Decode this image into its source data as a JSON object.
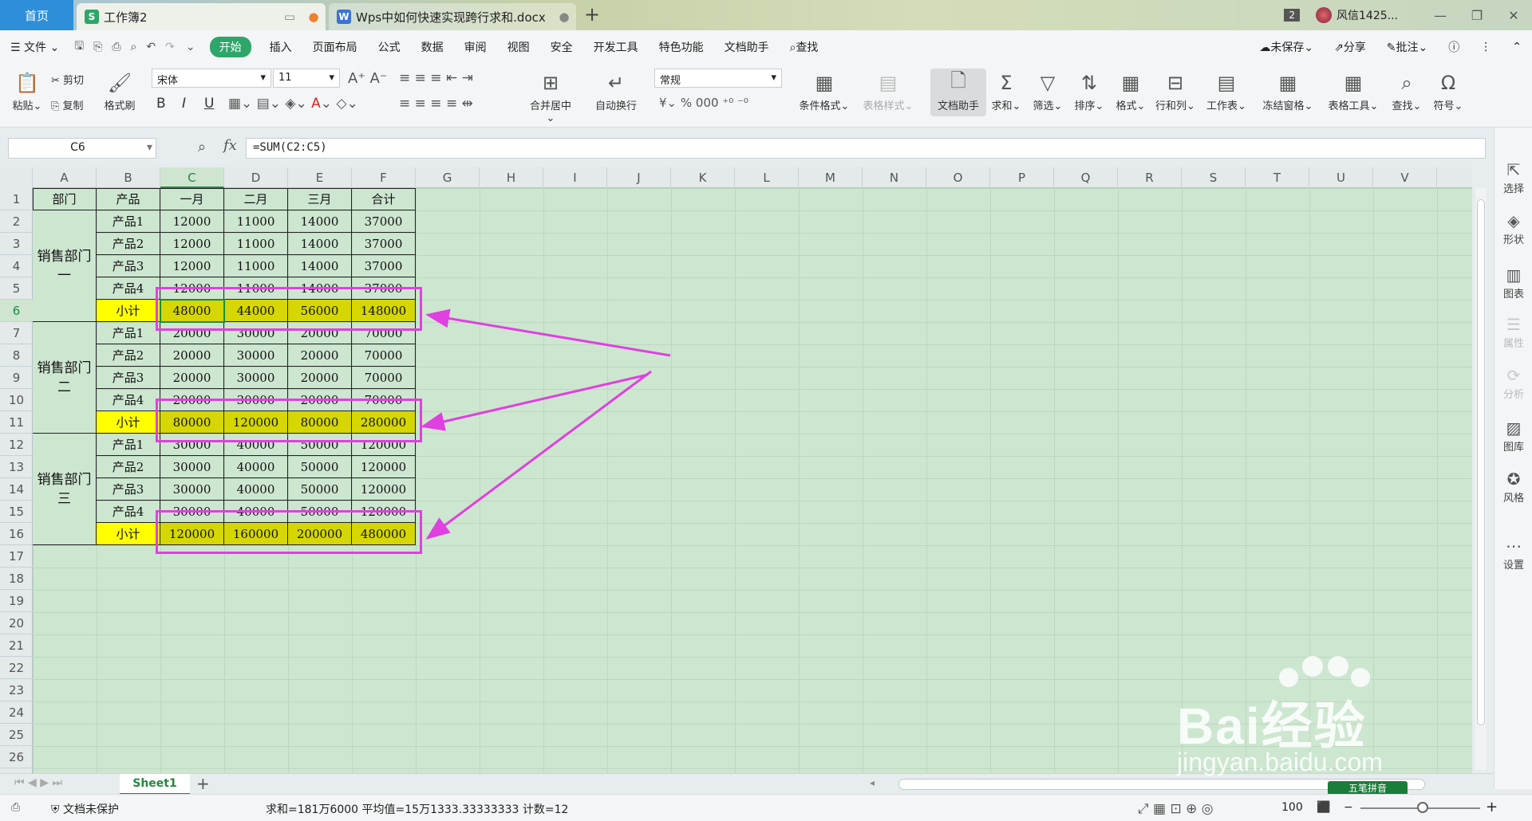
{
  "titlebar": {
    "home": "首页",
    "tab1": "工作簿2",
    "tab2": "Wps中如何快速实现跨行求和.docx",
    "count": "2",
    "user": "风信1425..."
  },
  "menu": {
    "file": "文件",
    "items": [
      "开始",
      "插入",
      "页面布局",
      "公式",
      "数据",
      "审阅",
      "视图",
      "安全",
      "开发工具",
      "特色功能",
      "文档助手",
      "查找"
    ],
    "unsaved": "未保存",
    "share": "分享",
    "comment": "批注"
  },
  "ribbon": {
    "paste": "粘贴",
    "cut": "剪切",
    "copy": "复制",
    "format_painter": "格式刷",
    "font": "宋体",
    "font_size": "11",
    "bold": "B",
    "italic": "I",
    "underline": "U",
    "merge": "合并居中",
    "wrap": "自动换行",
    "number_format": "常规",
    "cond_format": "条件格式",
    "table_style": "表格样式",
    "doc_helper": "文档助手",
    "sum": "求和",
    "filter": "筛选",
    "sort": "排序",
    "format": "格式",
    "rowcol": "行和列",
    "worksheet": "工作表",
    "freeze": "冻结窗格",
    "table_tools": "表格工具",
    "find": "查找",
    "symbol": "符号"
  },
  "formula_bar": {
    "cell_ref": "C6",
    "fx": "fx",
    "formula": "=SUM(C2:C5)"
  },
  "columns": [
    "A",
    "B",
    "C",
    "D",
    "E",
    "F",
    "G",
    "H",
    "I",
    "J",
    "K",
    "L",
    "M",
    "N",
    "O",
    "P",
    "Q",
    "R",
    "S",
    "T",
    "U",
    "V"
  ],
  "rows": [
    "1",
    "2",
    "3",
    "4",
    "5",
    "6",
    "7",
    "8",
    "9",
    "10",
    "11",
    "12",
    "13",
    "14",
    "15",
    "16",
    "17",
    "18",
    "19",
    "20",
    "21",
    "22",
    "23",
    "24",
    "25",
    "26"
  ],
  "table": {
    "header": [
      "部门",
      "产品",
      "一月",
      "二月",
      "三月",
      "合计"
    ],
    "groups": [
      {
        "dept": "销售部门一",
        "rows": [
          [
            "产品1",
            "12000",
            "11000",
            "14000",
            "37000"
          ],
          [
            "产品2",
            "12000",
            "11000",
            "14000",
            "37000"
          ],
          [
            "产品3",
            "12000",
            "11000",
            "14000",
            "37000"
          ],
          [
            "产品4",
            "12000",
            "11000",
            "14000",
            "37000"
          ]
        ],
        "subtotal": [
          "小计",
          "48000",
          "44000",
          "56000",
          "148000"
        ]
      },
      {
        "dept": "销售部门二",
        "rows": [
          [
            "产品1",
            "20000",
            "30000",
            "20000",
            "70000"
          ],
          [
            "产品2",
            "20000",
            "30000",
            "20000",
            "70000"
          ],
          [
            "产品3",
            "20000",
            "30000",
            "20000",
            "70000"
          ],
          [
            "产品4",
            "20000",
            "30000",
            "20000",
            "70000"
          ]
        ],
        "subtotal": [
          "小计",
          "80000",
          "120000",
          "80000",
          "280000"
        ]
      },
      {
        "dept": "销售部门三",
        "rows": [
          [
            "产品1",
            "30000",
            "40000",
            "50000",
            "120000"
          ],
          [
            "产品2",
            "30000",
            "40000",
            "50000",
            "120000"
          ],
          [
            "产品3",
            "30000",
            "40000",
            "50000",
            "120000"
          ],
          [
            "产品4",
            "30000",
            "40000",
            "50000",
            "120000"
          ]
        ],
        "subtotal": [
          "小计",
          "120000",
          "160000",
          "200000",
          "480000"
        ]
      }
    ]
  },
  "sidebar": [
    "选择",
    "形状",
    "图表",
    "属性",
    "分析",
    "图库",
    "风格",
    "设置"
  ],
  "sheet": {
    "name": "Sheet1",
    "add": "+"
  },
  "status": {
    "protect": "文档未保护",
    "stats": "求和=181万6000  平均值=15万1333.33333333  计数=12",
    "zoom": "100"
  },
  "ime": "五笔拼音",
  "watermark": {
    "main": "Bai经验",
    "sub": "jingyan.baidu.com"
  }
}
